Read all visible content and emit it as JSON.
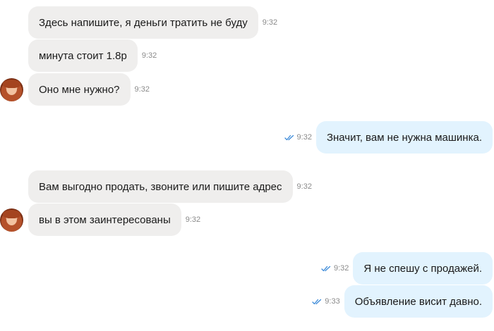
{
  "messages": [
    {
      "text": "Здесь напишите, я деньги тратить не буду",
      "time": "9:32"
    },
    {
      "text": "минута стоит 1.8р",
      "time": "9:32"
    },
    {
      "text": "Оно мне нужно?",
      "time": "9:32"
    },
    {
      "text": "Значит, вам не нужна машинка.",
      "time": "9:32"
    },
    {
      "text": "Вам выгодно продать, звоните или пишите адрес",
      "time": "9:32"
    },
    {
      "text": "вы в этом заинтересованы",
      "time": "9:32"
    },
    {
      "text": "Я не спешу с продажей.",
      "time": "9:32"
    },
    {
      "text": "Объявление висит давно.",
      "time": "9:33"
    }
  ],
  "colors": {
    "incoming_bubble": "#efeeed",
    "outgoing_bubble": "#e2f3fe",
    "read_checks": "#3d8bd9"
  },
  "icons": {
    "avatar": "contact-avatar",
    "read_status": "double-check-icon"
  }
}
